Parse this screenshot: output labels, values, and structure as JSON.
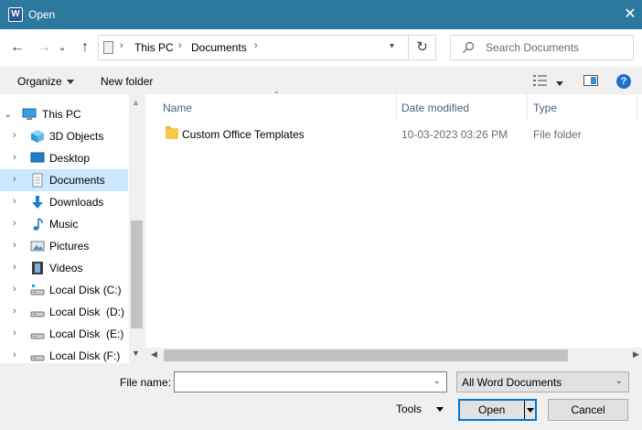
{
  "window": {
    "title": "Open",
    "app_icon": "word-icon",
    "close_glyph": "✕"
  },
  "nav_buttons": {
    "back": "←",
    "forward": "→",
    "recent": "⌄",
    "up": "↑"
  },
  "address": {
    "breadcrumbs": [
      "This PC",
      "Documents"
    ],
    "separator": "›",
    "refresh_glyph": "↻"
  },
  "search": {
    "placeholder": "Search Documents"
  },
  "toolbar": {
    "organize": "Organize",
    "new_folder": "New folder",
    "help": "?"
  },
  "sidebar": {
    "items": [
      {
        "label": "This PC",
        "icon": "computer-icon",
        "expanded": true
      },
      {
        "label": "3D Objects",
        "icon": "cube-icon"
      },
      {
        "label": "Desktop",
        "icon": "desktop-icon"
      },
      {
        "label": "Documents",
        "icon": "documents-icon",
        "selected": true
      },
      {
        "label": "Downloads",
        "icon": "download-icon"
      },
      {
        "label": "Music",
        "icon": "music-icon"
      },
      {
        "label": "Pictures",
        "icon": "pictures-icon"
      },
      {
        "label": "Videos",
        "icon": "videos-icon"
      },
      {
        "label": "Local Disk (C:)",
        "icon": "drive-icon"
      },
      {
        "label": "Local Disk  (D:)",
        "icon": "drive-icon"
      },
      {
        "label": "Local Disk  (E:)",
        "icon": "drive-icon"
      },
      {
        "label": "Local Disk (F:)",
        "icon": "drive-icon"
      }
    ]
  },
  "file_list": {
    "columns": [
      "Name",
      "Date modified",
      "Type"
    ],
    "rows": [
      {
        "name": "Custom Office Templates",
        "date_modified": "10-03-2023 03:26 PM",
        "type": "File folder",
        "icon": "folder-icon"
      }
    ]
  },
  "bottom": {
    "file_name_label": "File name:",
    "file_name_value": "",
    "file_type_selected": "All Word Documents",
    "tools": "Tools",
    "open": "Open",
    "cancel": "Cancel"
  },
  "colors": {
    "titlebar": "#2b7a9e",
    "selection": "#cce8ff",
    "accent": "#0078d7"
  }
}
